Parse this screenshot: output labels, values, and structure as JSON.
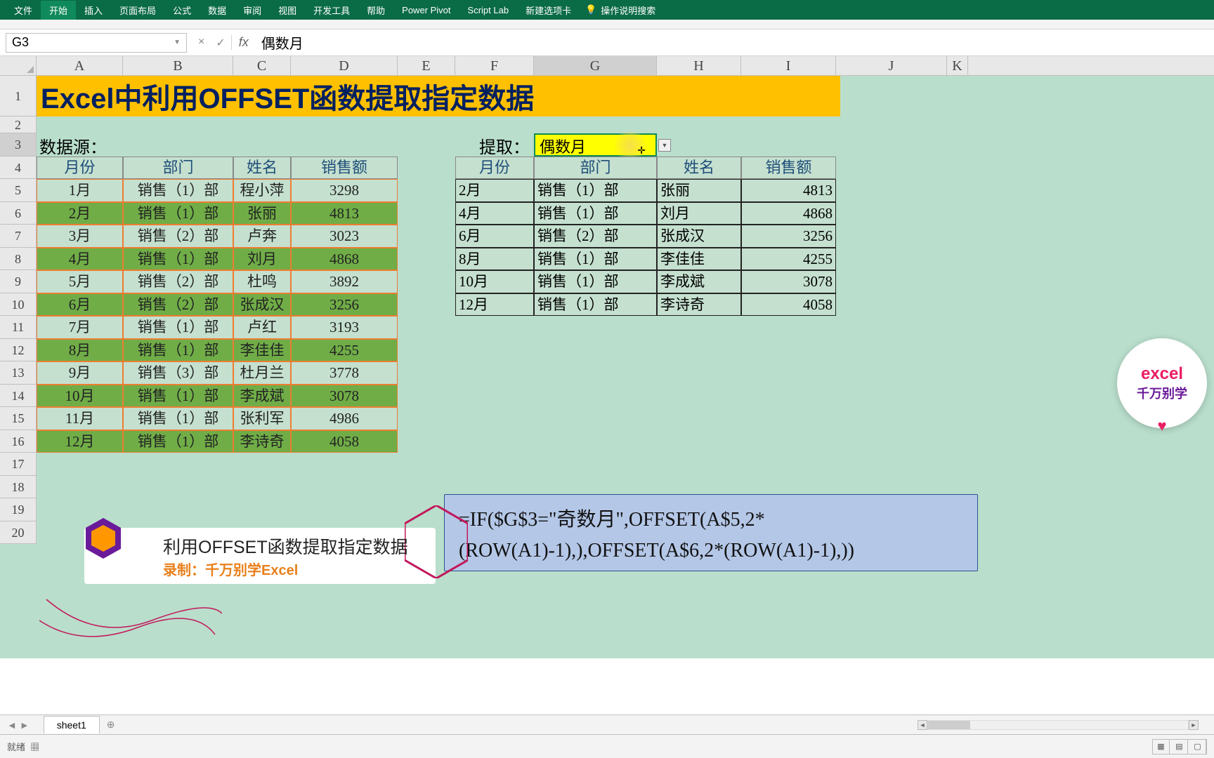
{
  "ribbon": {
    "tabs": [
      "文件",
      "开始",
      "插入",
      "页面布局",
      "公式",
      "数据",
      "审阅",
      "视图",
      "开发工具",
      "帮助",
      "Power Pivot",
      "Script Lab",
      "新建选项卡"
    ],
    "search": "操作说明搜索"
  },
  "formula_bar": {
    "name_box": "G3",
    "buttons": {
      "cancel": "×",
      "confirm": "✓",
      "fx": "fx"
    },
    "value": "偶数月"
  },
  "columns": [
    "A",
    "B",
    "C",
    "D",
    "E",
    "F",
    "G",
    "H",
    "I",
    "J",
    "K"
  ],
  "row_nums": [
    "1",
    "2",
    "3",
    "4",
    "5",
    "6",
    "7",
    "8",
    "9",
    "10",
    "11",
    "12",
    "13",
    "14",
    "15",
    "16",
    "17",
    "18",
    "19",
    "20"
  ],
  "title": "Excel中利用OFFSET函数提取指定数据",
  "labels": {
    "source": "数据源：",
    "extract": "提取：",
    "dropdown_value": "偶数月"
  },
  "source_table": {
    "headers": [
      "月份",
      "部门",
      "姓名",
      "销售额"
    ],
    "rows": [
      {
        "m": "1月",
        "d": "销售（1）部",
        "n": "程小萍",
        "s": "3298",
        "even": false
      },
      {
        "m": "2月",
        "d": "销售（1）部",
        "n": "张丽",
        "s": "4813",
        "even": true
      },
      {
        "m": "3月",
        "d": "销售（2）部",
        "n": "卢奔",
        "s": "3023",
        "even": false
      },
      {
        "m": "4月",
        "d": "销售（1）部",
        "n": "刘月",
        "s": "4868",
        "even": true
      },
      {
        "m": "5月",
        "d": "销售（2）部",
        "n": "杜鸣",
        "s": "3892",
        "even": false
      },
      {
        "m": "6月",
        "d": "销售（2）部",
        "n": "张成汉",
        "s": "3256",
        "even": true
      },
      {
        "m": "7月",
        "d": "销售（1）部",
        "n": "卢红",
        "s": "3193",
        "even": false
      },
      {
        "m": "8月",
        "d": "销售（1）部",
        "n": "李佳佳",
        "s": "4255",
        "even": true
      },
      {
        "m": "9月",
        "d": "销售（3）部",
        "n": "杜月兰",
        "s": "3778",
        "even": false
      },
      {
        "m": "10月",
        "d": "销售（1）部",
        "n": "李成斌",
        "s": "3078",
        "even": true
      },
      {
        "m": "11月",
        "d": "销售（1）部",
        "n": "张利军",
        "s": "4986",
        "even": false
      },
      {
        "m": "12月",
        "d": "销售（1）部",
        "n": "李诗奇",
        "s": "4058",
        "even": true
      }
    ]
  },
  "result_table": {
    "headers": [
      "月份",
      "部门",
      "姓名",
      "销售额"
    ],
    "rows": [
      {
        "m": "2月",
        "d": "销售（1）部",
        "n": "张丽",
        "s": "4813"
      },
      {
        "m": "4月",
        "d": "销售（1）部",
        "n": "刘月",
        "s": "4868"
      },
      {
        "m": "6月",
        "d": "销售（2）部",
        "n": "张成汉",
        "s": "3256"
      },
      {
        "m": "8月",
        "d": "销售（1）部",
        "n": "李佳佳",
        "s": "4255"
      },
      {
        "m": "10月",
        "d": "销售（1）部",
        "n": "李成斌",
        "s": "3078"
      },
      {
        "m": "12月",
        "d": "销售（1）部",
        "n": "李诗奇",
        "s": "4058"
      }
    ]
  },
  "formula_box": "=IF($G$3=\"奇数月\",OFFSET(A$5,2*(ROW(A1)-1),),OFFSET(A$6,2*(ROW(A1)-1),))",
  "caption": {
    "title": "利用OFFSET函数提取指定数据",
    "sub": "录制：千万别学Excel"
  },
  "watermark": {
    "l1": "excel",
    "l2": "千万别学"
  },
  "sheet": {
    "name": "sheet1",
    "add": "⊕"
  },
  "status": {
    "ready": "就绪"
  }
}
